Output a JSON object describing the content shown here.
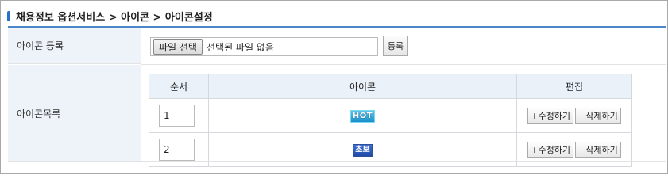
{
  "breadcrumb": {
    "path": "채용정보 옵션서비스 > 아이콘 > 아이콘설정"
  },
  "register": {
    "label": "아이콘 등록",
    "file_button": "파일 선택",
    "file_status": "선택된 파일 없음",
    "submit": "등록"
  },
  "list": {
    "label": "아이콘목록",
    "headers": {
      "order": "순서",
      "icon": "아이콘",
      "edit": "편집"
    },
    "rows": [
      {
        "order": "1",
        "icon_text": "HOT",
        "icon": "hot-icon",
        "edit": "+수정하기",
        "delete": "−삭제하기"
      },
      {
        "order": "2",
        "icon_text": "초보",
        "icon": "beginner-icon",
        "edit": "+수정하기",
        "delete": "−삭제하기"
      }
    ]
  },
  "colors": {
    "accent": "#4a86c8",
    "label_bg": "#eef3fa",
    "header_bg": "#eaf1f9"
  }
}
